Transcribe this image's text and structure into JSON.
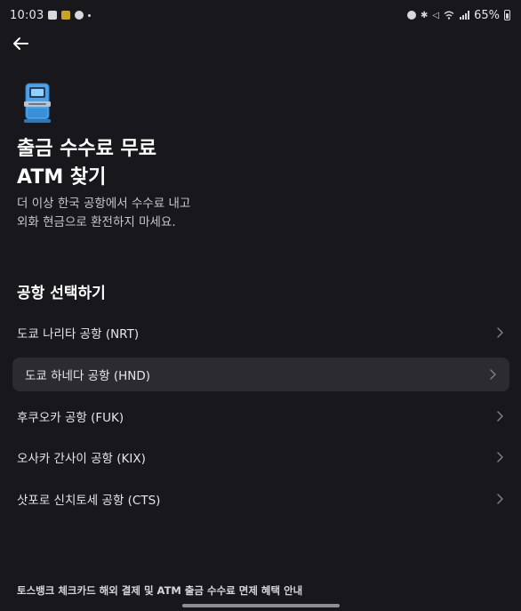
{
  "status_bar": {
    "time": "10:03",
    "battery_percent": "65%",
    "left_icons": [
      "gallery-icon",
      "app-notification-icon",
      "cloud-icon",
      "more-dot-icon"
    ],
    "right_icons": [
      "alarm-icon",
      "bluetooth-icon",
      "mute-icon",
      "wifi-icon",
      "signal-icon",
      "battery-icon"
    ]
  },
  "header": {
    "back_icon": "arrow-left-icon"
  },
  "hero": {
    "icon": "atm-icon",
    "title_line1": "출금 수수료 무료",
    "title_line2": "ATM 찾기",
    "desc_line1": "더 이상 한국 공항에서 수수료 내고",
    "desc_line2": "외화 현금으로 환전하지 마세요."
  },
  "section": {
    "title": "공항 선택하기"
  },
  "airports": [
    {
      "label": "도쿄 나리타 공항 (NRT)",
      "active": false
    },
    {
      "label": "도쿄 하네다 공항 (HND)",
      "active": true
    },
    {
      "label": "후쿠오카 공항 (FUK)",
      "active": false
    },
    {
      "label": "오사카 간사이 공항 (KIX)",
      "active": false
    },
    {
      "label": "삿포로 신치토세 공항 (CTS)",
      "active": false
    }
  ],
  "footer": {
    "link_text": "토스뱅크 체크카드 해외 결제 및 ATM 출금 수수료 면제 혜택 안내"
  },
  "colors": {
    "background": "#17171c",
    "active_row": "#2b2b31",
    "text_primary": "#ffffff",
    "text_secondary": "#c7c7cc"
  }
}
